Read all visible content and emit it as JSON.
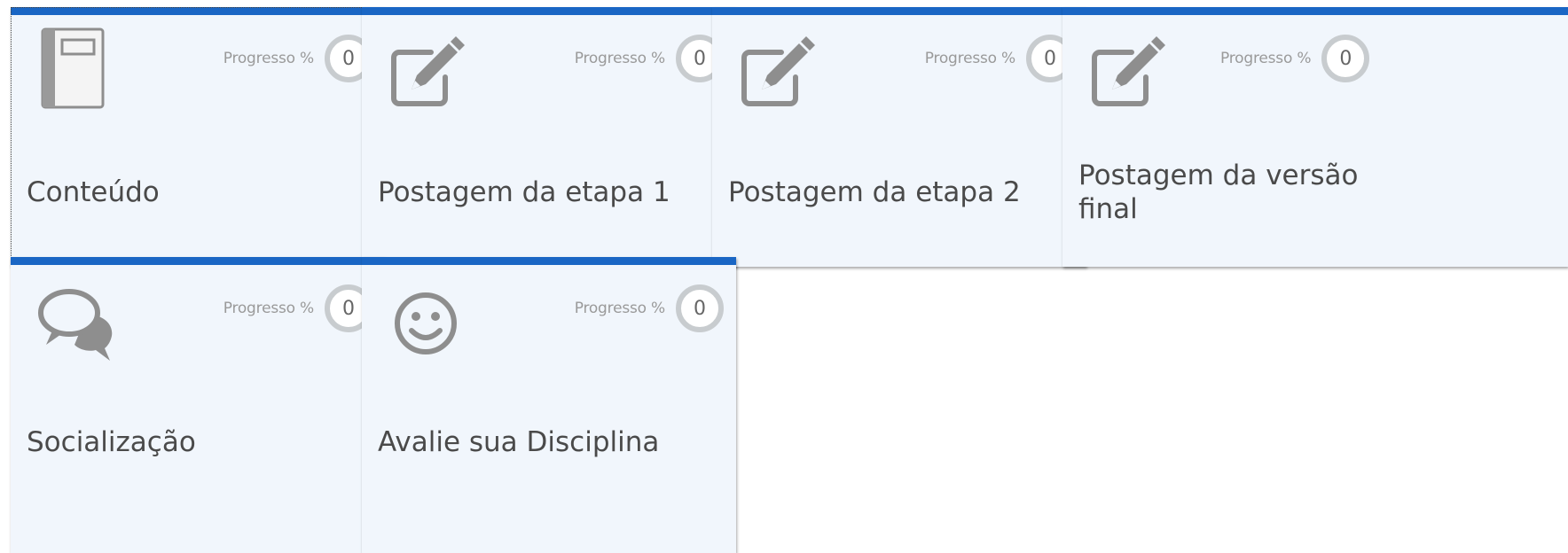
{
  "progress_label": "Progresso %",
  "accent_color": "#1a66c4",
  "cards": [
    {
      "title": "Conteúdo",
      "progress": "0",
      "icon": "notebook-icon"
    },
    {
      "title": "Postagem da etapa 1",
      "progress": "0",
      "icon": "edit-icon"
    },
    {
      "title": "Postagem da etapa 2",
      "progress": "0",
      "icon": "edit-icon"
    },
    {
      "title": "Postagem da versão final",
      "progress": "0",
      "icon": "edit-icon"
    },
    {
      "title": "Socialização",
      "progress": "0",
      "icon": "chat-bubbles-icon"
    },
    {
      "title": "Avalie sua Disciplina",
      "progress": "0",
      "icon": "smiley-icon"
    }
  ]
}
